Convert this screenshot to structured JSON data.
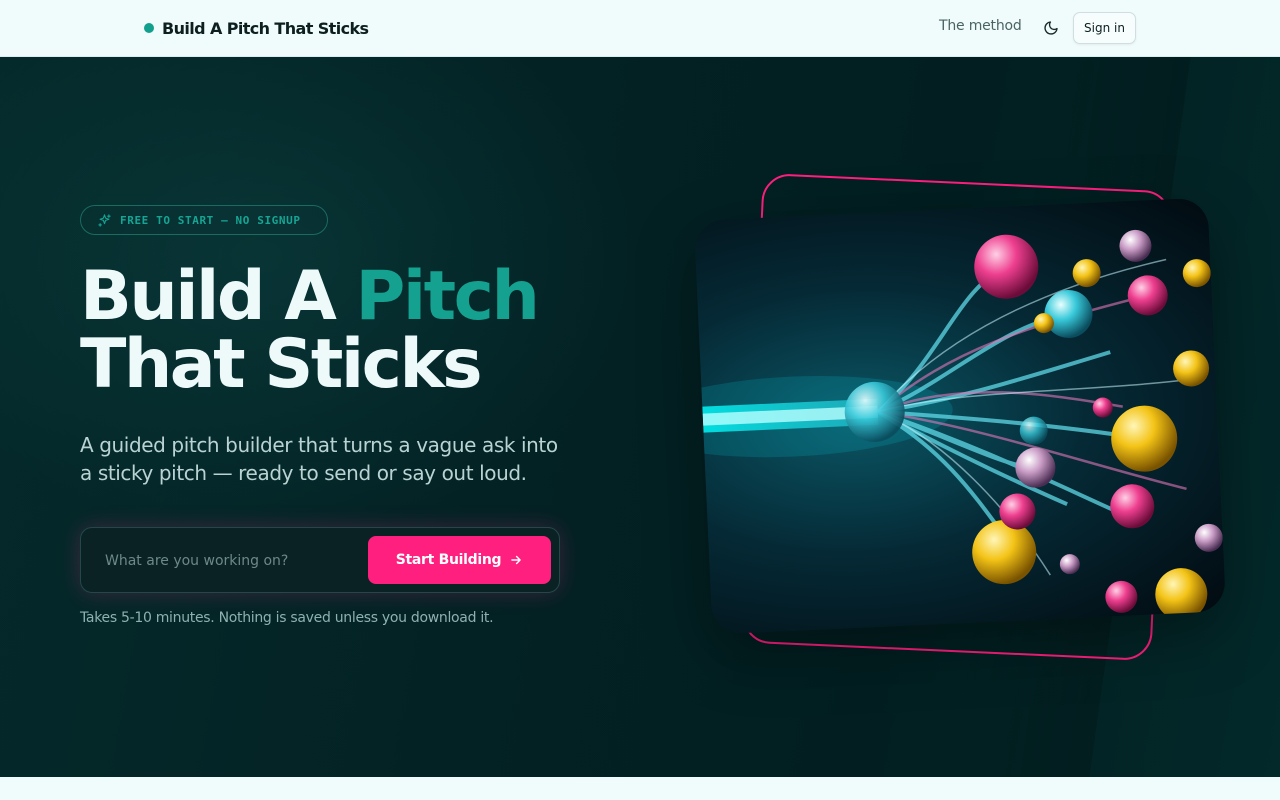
{
  "header": {
    "brand_name": "Build A Pitch That Sticks",
    "nav_method": "The method",
    "sign_in": "Sign in",
    "theme_icon": "moon-icon"
  },
  "hero": {
    "badge_text": "FREE TO START — NO SIGNUP",
    "badge_icon": "sparkles-icon",
    "headline_part1": "Build A ",
    "headline_accent": "Pitch",
    "headline_part2": "That Sticks",
    "subhead": "A guided pitch builder that turns a vague ask into a sticky pitch — ready to send or say out loud.",
    "input_placeholder": "What are you working on?",
    "input_value": "",
    "cta_label": "Start Building",
    "cta_icon": "arrow-right-icon",
    "footnote": "Takes 5-10 minutes. Nothing is saved unless you download it."
  },
  "colors": {
    "accent_teal": "#15a190",
    "accent_pink": "#ff1f7f",
    "hero_bg": "#032224",
    "page_bg": "#f0fbfb"
  }
}
